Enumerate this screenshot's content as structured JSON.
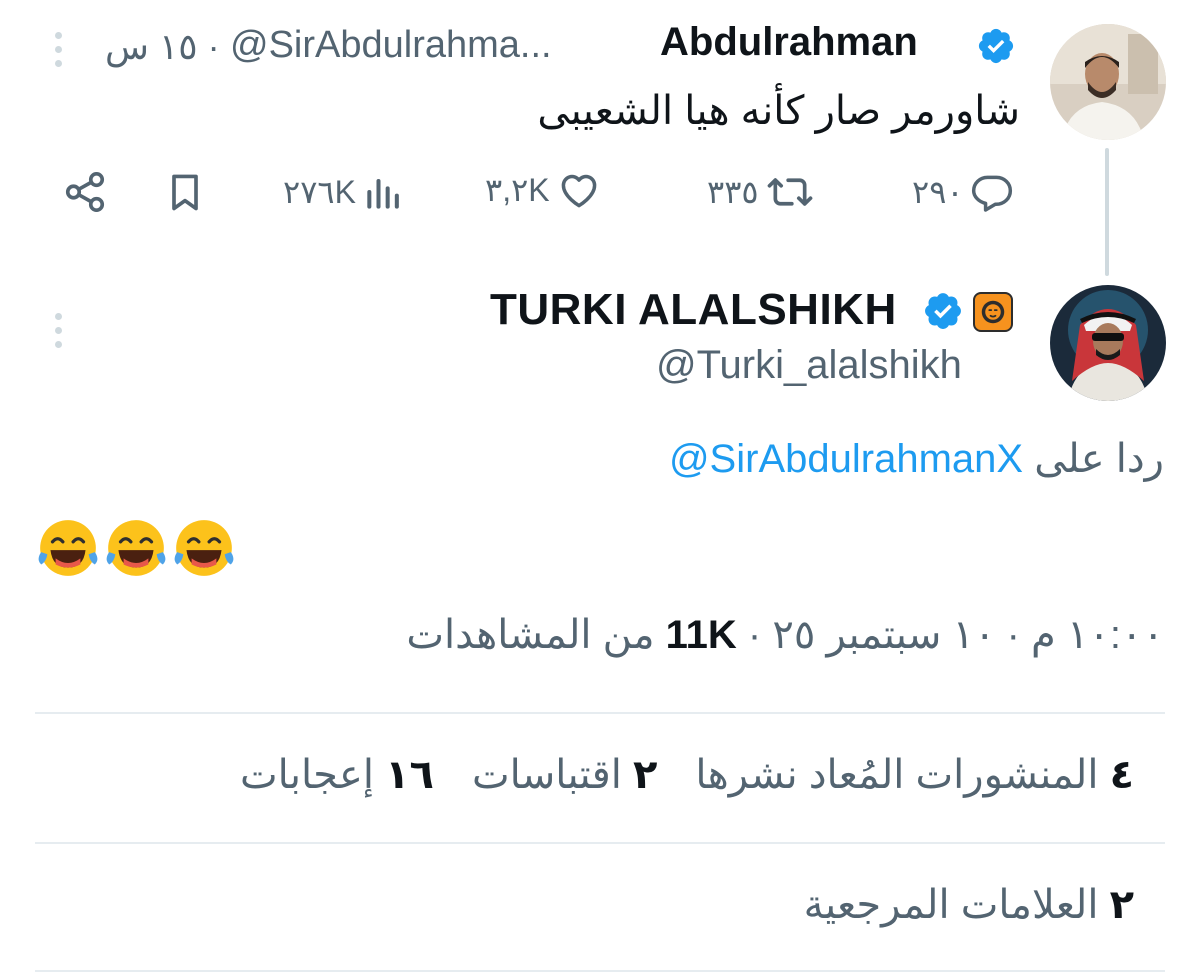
{
  "parent_tweet": {
    "name": "Abdulrahman",
    "handle": "@SirAbdulrahma...",
    "separator": "·",
    "time": "١٥ س",
    "text": "شاورمر صار كأنه هيا الشعيبى",
    "actions": {
      "reply_count": "٢٩٠",
      "retweet_count": "٣٣٥",
      "like_count": "٣,٢K",
      "view_count": "٢٧٦K"
    }
  },
  "main_tweet": {
    "name": "TURKI ALALSHIKH",
    "handle": "@Turki_alalshikh",
    "replying_label": "ردا على",
    "replying_to": "@SirAbdulrahmanX",
    "text": "😂😂😂",
    "meta": {
      "time": "١٠:٠٠ م",
      "dot": "·",
      "date": "١٠ سبتمبر ٢٥",
      "views_count": "11K",
      "views_label": "من المشاهدات"
    },
    "stats": [
      {
        "count": "٤",
        "label": "المنشورات المُعاد نشرها"
      },
      {
        "count": "٢",
        "label": "اقتباسات"
      },
      {
        "count": "١٦",
        "label": "إعجابات"
      }
    ],
    "bookmarks": {
      "count": "٢",
      "label": "العلامات المرجعية"
    }
  },
  "colors": {
    "verified": "#1d9bf0",
    "link": "#1d9bf0",
    "secondary_text": "#536471",
    "primary_text": "#0f1419",
    "divider": "#e6ecf0",
    "affiliate_badge": "#f6921e"
  },
  "icons": [
    "verified-badge-icon",
    "lion-affiliate-icon",
    "more-dots-icon",
    "reply-icon",
    "retweet-icon",
    "like-icon",
    "views-icon",
    "bookmark-icon",
    "share-icon"
  ]
}
